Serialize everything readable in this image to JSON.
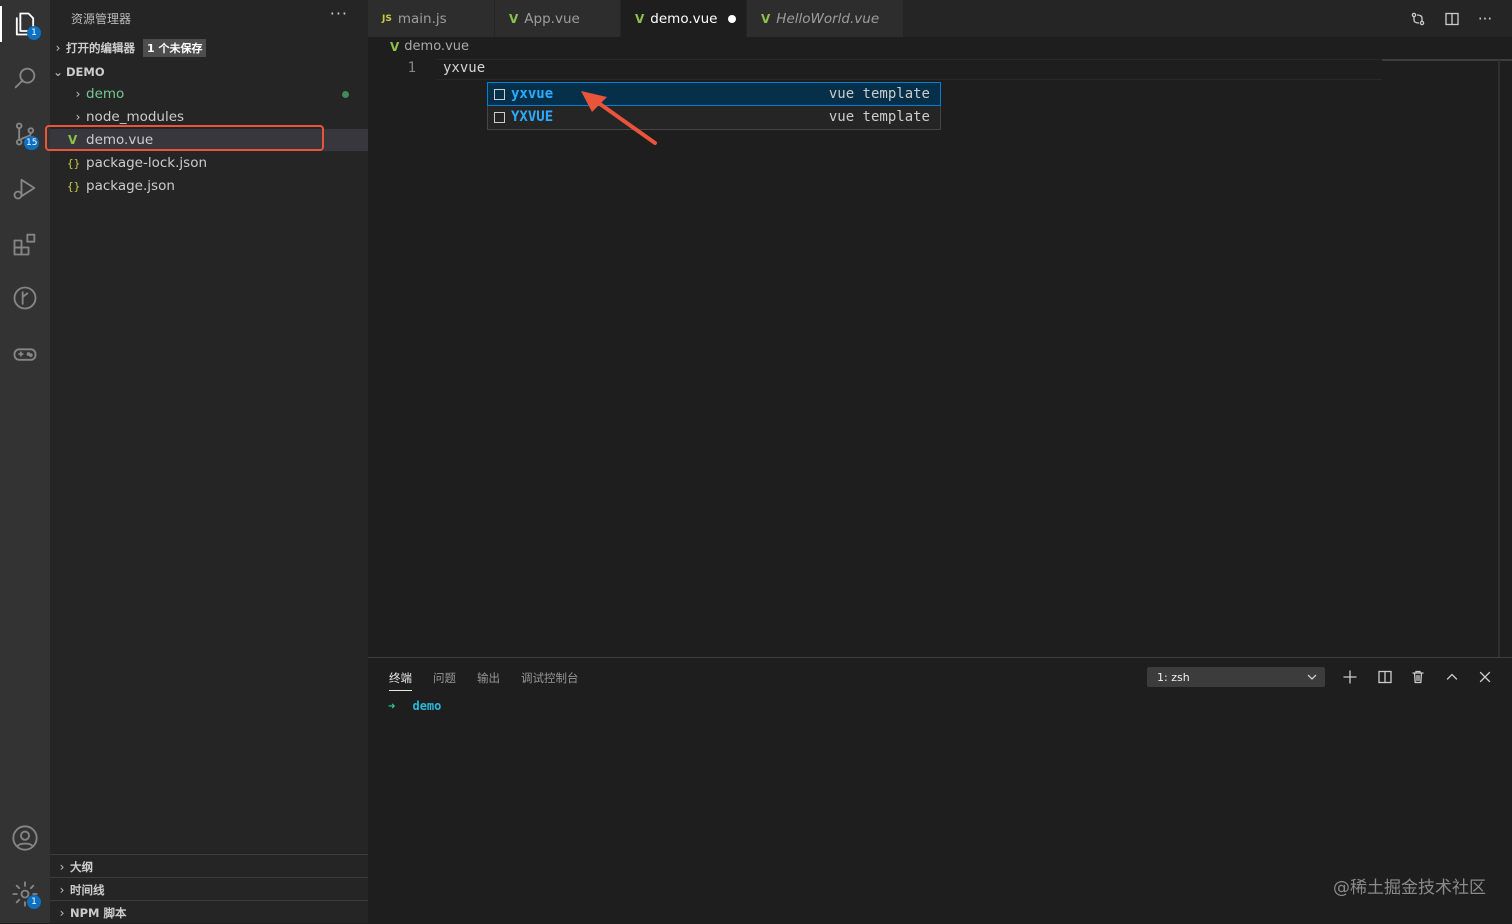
{
  "activity_bar": {
    "explorer_badge": "1",
    "scm_badge": "15",
    "settings_badge": "1"
  },
  "sidebar": {
    "title": "资源管理器",
    "more": "···",
    "open_editors": {
      "label": "打开的编辑器",
      "unsaved": "1 个未保存"
    },
    "workspace": "DEMO",
    "items": [
      {
        "label": "demo",
        "kind": "folder"
      },
      {
        "label": "node_modules",
        "kind": "folder"
      },
      {
        "label": "demo.vue",
        "kind": "vue"
      },
      {
        "label": "package-lock.json",
        "kind": "json"
      },
      {
        "label": "package.json",
        "kind": "json"
      }
    ],
    "bottom_sections": [
      "大纲",
      "时间线",
      "NPM 脚本"
    ]
  },
  "tabs": [
    {
      "label": "main.js",
      "icon": "JS"
    },
    {
      "label": "App.vue",
      "icon": "V"
    },
    {
      "label": "demo.vue",
      "icon": "V"
    },
    {
      "label": "HelloWorld.vue",
      "icon": "V"
    }
  ],
  "editor": {
    "breadcrumb": "demo.vue",
    "line_number": "1",
    "code": "yxvue",
    "suggestions": [
      {
        "label": "yxvue",
        "detail": "vue template"
      },
      {
        "label": "YXVUE",
        "detail": "vue template"
      }
    ]
  },
  "panel": {
    "tabs": [
      "终端",
      "问题",
      "输出",
      "调试控制台"
    ],
    "terminal_select": "1: zsh",
    "prompt_arrow": "➜",
    "prompt_dir": "demo"
  },
  "watermark": "@稀土掘金技术社区",
  "colors": {
    "accent": "#007fd4",
    "vue_green": "#8dc149",
    "highlight_box": "#e8553a",
    "terminal_cyan": "#29b8db",
    "terminal_green": "#23d18b",
    "folder_green": "#73c991"
  }
}
